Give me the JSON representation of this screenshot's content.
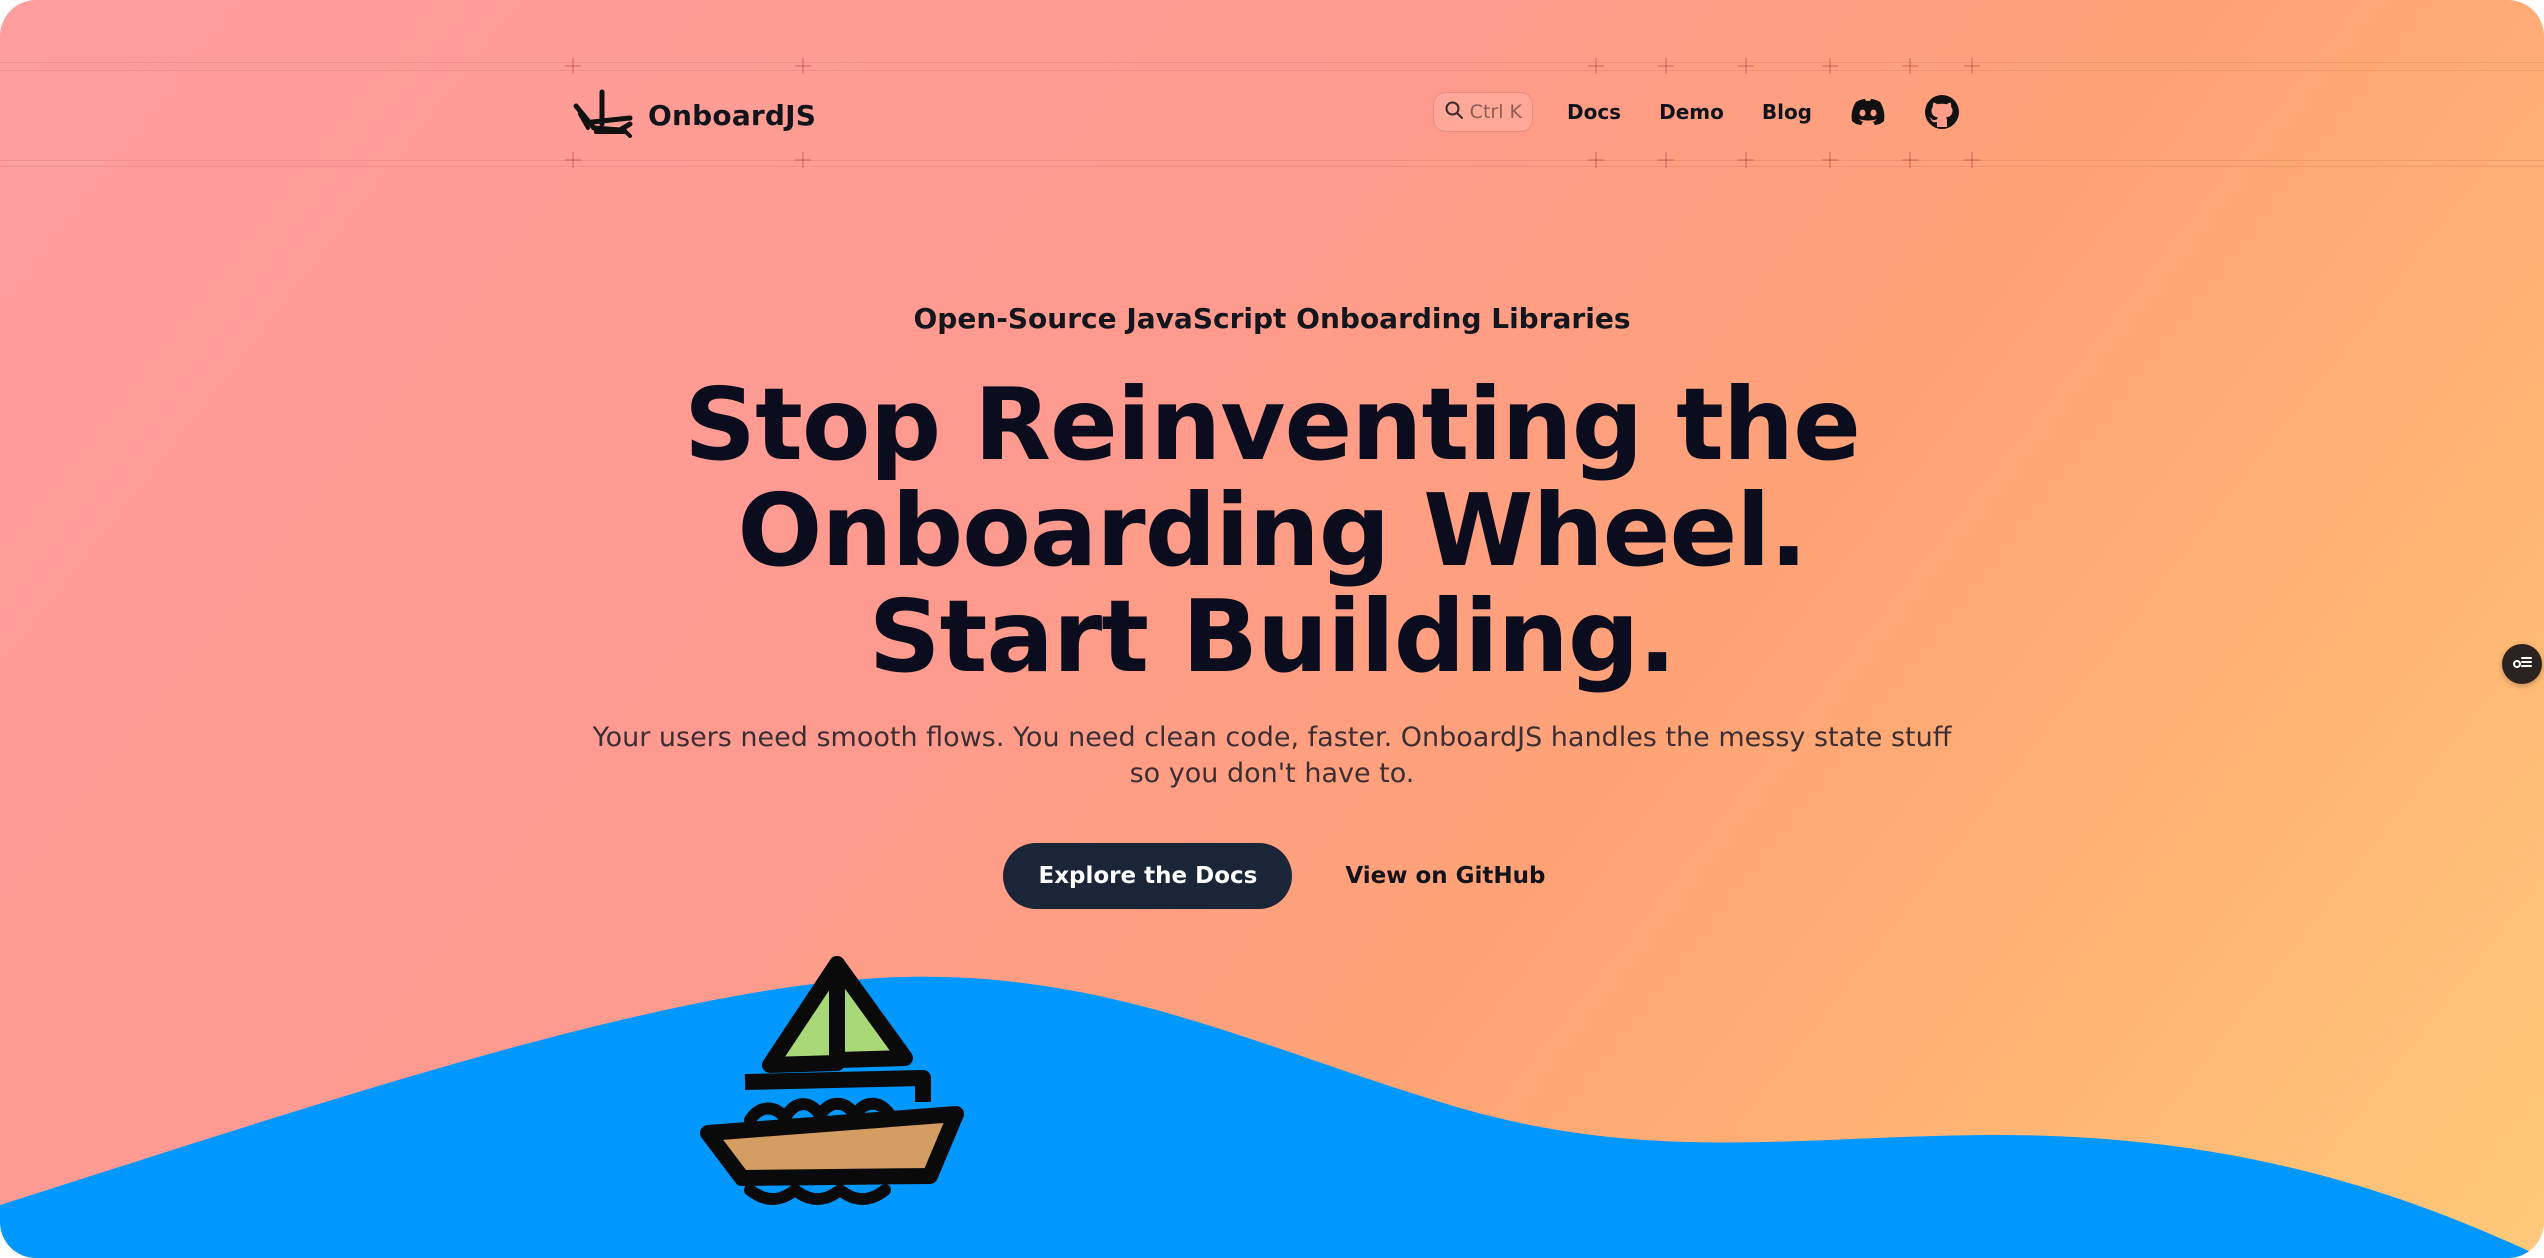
{
  "header": {
    "logo_text": "OnboardJS",
    "search": {
      "placeholder": "Ctrl K"
    },
    "nav": [
      {
        "label": "Docs"
      },
      {
        "label": "Demo"
      },
      {
        "label": "Blog"
      }
    ],
    "icons": [
      "search-icon",
      "discord-icon",
      "github-icon"
    ]
  },
  "hero": {
    "eyebrow": "Open-Source JavaScript Onboarding Libraries",
    "headline_lines": [
      "Stop Reinventing the",
      "Onboarding Wheel.",
      "Start Building."
    ],
    "sub_lines": [
      "Your users need smooth flows. You need clean code, faster. OnboardJS handles the messy state stuff",
      "so you don't have to."
    ],
    "primary_button": "Explore the Docs",
    "secondary_button": "View on GitHub"
  },
  "illustration": {
    "name": "boat-on-wave"
  },
  "colors": {
    "primary_button_bg": "#1b2538",
    "wave": "#0098ff",
    "sail": "#a8d878",
    "hull": "#d49e62",
    "text_dark": "#0b0d1e"
  }
}
